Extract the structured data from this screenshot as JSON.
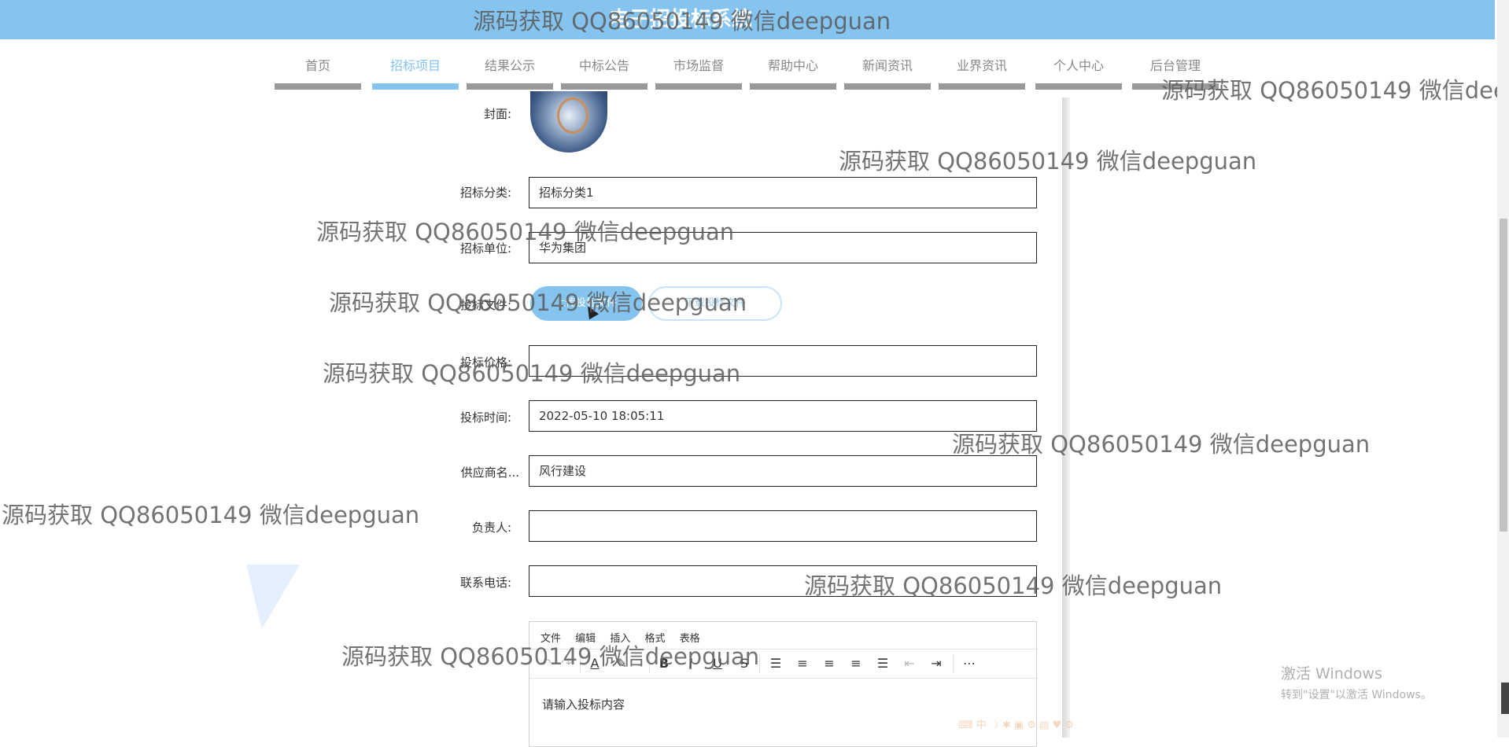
{
  "site": {
    "title": "电子招投标系统"
  },
  "nav": [
    {
      "label": "首页",
      "active": false
    },
    {
      "label": "招标项目",
      "active": true
    },
    {
      "label": "结果公示",
      "active": false
    },
    {
      "label": "中标公告",
      "active": false
    },
    {
      "label": "市场监督",
      "active": false
    },
    {
      "label": "帮助中心",
      "active": false
    },
    {
      "label": "新闻资讯",
      "active": false
    },
    {
      "label": "业界资讯",
      "active": false
    },
    {
      "label": "个人中心",
      "active": false
    },
    {
      "label": "后台管理",
      "active": false
    }
  ],
  "form": {
    "cover_label": "封面:",
    "category_label": "招标分类:",
    "category_value": "招标分类1",
    "unit_label": "招标单位:",
    "unit_value": "华为集团",
    "file_label": "投标文件:",
    "upload_label": "上传投标文件",
    "download_label": "下载投标文件",
    "price_label": "投标价格:",
    "price_value": "",
    "time_label": "投标时间:",
    "time_value": "2022-05-10 18:05:11",
    "supplier_label": "供应商名...",
    "supplier_value": "风行建设",
    "manager_label": "负责人:",
    "manager_value": "",
    "phone_label": "联系电话:",
    "phone_value": ""
  },
  "editor": {
    "menu": [
      "文件",
      "编辑",
      "插入",
      "格式",
      "表格"
    ],
    "placeholder": "请输入投标内容",
    "toolbar_icons": [
      "undo-icon",
      "redo-icon",
      "font-color-icon",
      "highlight-icon",
      "bold-icon",
      "italic-icon",
      "underline-icon",
      "strikethrough-icon",
      "ordered-list-icon",
      "align-left-icon",
      "align-center-icon",
      "align-right-icon",
      "align-justify-icon",
      "outdent-icon",
      "indent-icon",
      "more-icon"
    ]
  },
  "watermark_text": "源码获取 QQ86050149 微信deepguan",
  "windows_activation": {
    "title": "激活 Windows",
    "subtitle": "转到\"设置\"以激活 Windows。"
  },
  "colors": {
    "accent": "#84c4ef",
    "nav_bar": "#9a9a9a"
  }
}
